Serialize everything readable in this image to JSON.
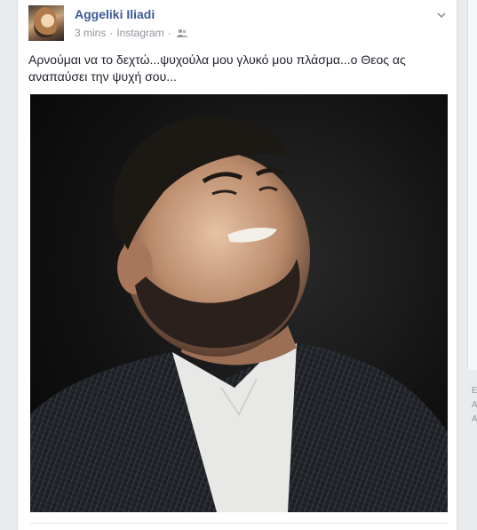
{
  "post": {
    "author": "Aggeliki Iliadi",
    "time": "3 mins",
    "separator": "·",
    "source": "Instagram",
    "text": "Αρνούμαι να το δεχτώ...ψυχούλα μου γλυκό μου πλάσμα...ο Θεος ας αναπαύσει την ψυχή σου...",
    "audience_icon": "friends-icon",
    "menu_icon": "chevron-down-icon"
  },
  "sidebar": {
    "letters": [
      "E",
      "A",
      "A"
    ]
  },
  "colors": {
    "name_link": "#3b5998",
    "meta_text": "#90949c",
    "post_text": "#1d2129",
    "background": "#e9ebee"
  }
}
